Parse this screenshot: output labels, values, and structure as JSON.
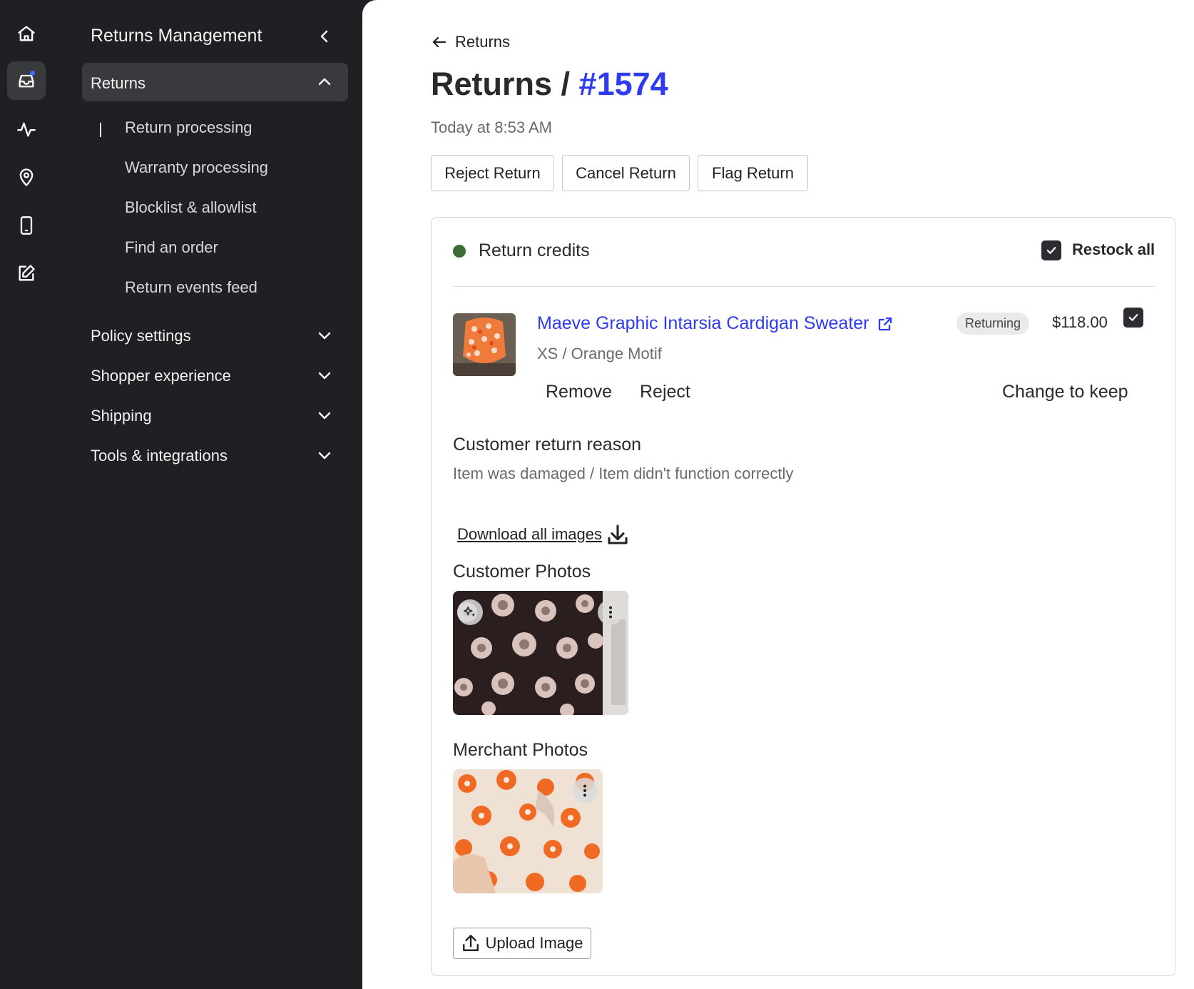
{
  "rail": {
    "items": [
      {
        "icon": "home-icon"
      },
      {
        "icon": "inbox-icon",
        "active": true
      },
      {
        "icon": "activity-icon"
      },
      {
        "icon": "map-pin-icon"
      },
      {
        "icon": "mobile-icon"
      },
      {
        "icon": "edit-icon"
      }
    ]
  },
  "sidebar": {
    "title": "Returns Management",
    "active_section": "Returns",
    "subitems": [
      "Return processing",
      "Warranty processing",
      "Blocklist & allowlist",
      "Find an order",
      "Return events feed"
    ],
    "sections": [
      "Policy settings",
      "Shopper experience",
      "Shipping",
      "Tools & integrations"
    ]
  },
  "main": {
    "back_label": "Returns",
    "title_prefix": "Returns /",
    "title_number": "#1574",
    "timestamp": "Today at 8:53 AM",
    "actions": {
      "reject": "Reject Return",
      "cancel": "Cancel Return",
      "flag": "Flag Return"
    },
    "card": {
      "title": "Return credits",
      "status_color": "#3c6b33",
      "restock_label": "Restock all",
      "restock_checked": true,
      "item": {
        "name": "Maeve Graphic Intarsia Cardigan Sweater",
        "variant": "XS / Orange Motif",
        "status": "Returning",
        "price": "$118.00",
        "checked": true,
        "remove_label": "Remove",
        "reject_label": "Reject",
        "keep_label": "Change to keep"
      },
      "reason_heading": "Customer return reason",
      "reason_text": "Item was damaged / Item didn't function correctly",
      "download_label": "Download all images",
      "customer_photos_heading": "Customer Photos",
      "merchant_photos_heading": "Merchant Photos",
      "upload_label": "Upload Image"
    }
  },
  "colors": {
    "accent": "#2e3bef",
    "sidebar_bg": "#1f2023",
    "active_bg": "#393a3e"
  }
}
